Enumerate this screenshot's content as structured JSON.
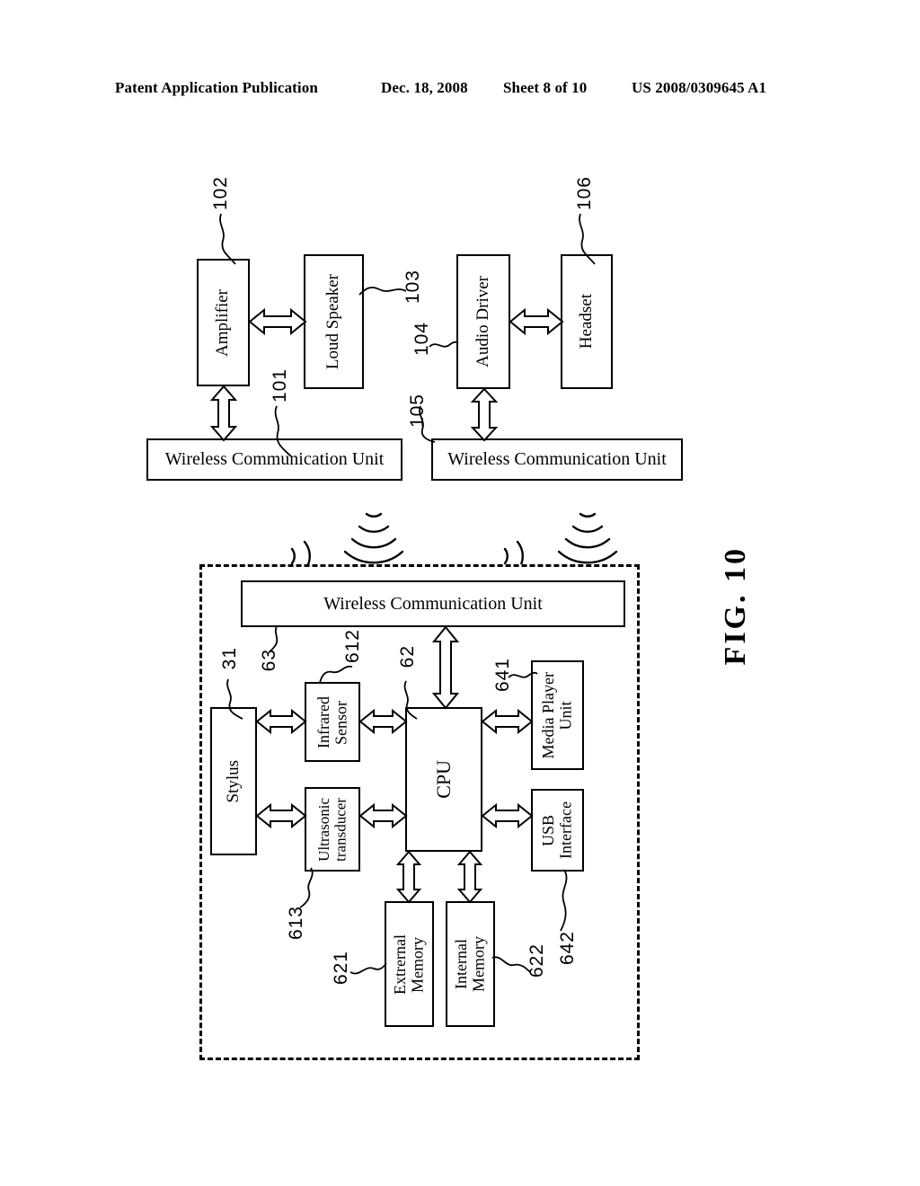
{
  "header": {
    "publication": "Patent Application Publication",
    "date": "Dec. 18, 2008",
    "sheet": "Sheet 8 of 10",
    "patent_number": "US 2008/0309645 A1"
  },
  "figure": {
    "caption": "FIG. 10"
  },
  "blocks": {
    "amplifier": "Amplifier",
    "loud_speaker": "Loud Speaker",
    "audio_driver": "Audio Driver",
    "headset": "Headset",
    "wcu_left": "Wireless Communication Unit",
    "wcu_right": "Wireless Communication Unit",
    "wcu_device": "Wireless Communication Unit",
    "stylus": "Stylus",
    "infrared_sensor": "Infrared\nSensor",
    "ultrasonic_transducer": "Ultrasonic\ntransducer",
    "cpu": "CPU",
    "media_player_unit": "Media Player\nUnit",
    "usb_interface": "USB\nInterface",
    "external_memory": "Extrernal\nMemory",
    "internal_memory": "Internal\nMemory"
  },
  "refnums": {
    "amplifier": "102",
    "wcu_left": "101",
    "loud_speaker": "103",
    "audio_driver": "104",
    "wcu_right": "105",
    "headset": "106",
    "stylus": "31",
    "wcu_device": "63",
    "infrared_sensor": "612",
    "cpu": "62",
    "media_player_unit": "641",
    "ultrasonic_transducer": "613",
    "external_memory": "621",
    "internal_memory": "622",
    "usb_interface": "642"
  },
  "colors": {
    "ink": "#000000",
    "paper": "#ffffff"
  }
}
